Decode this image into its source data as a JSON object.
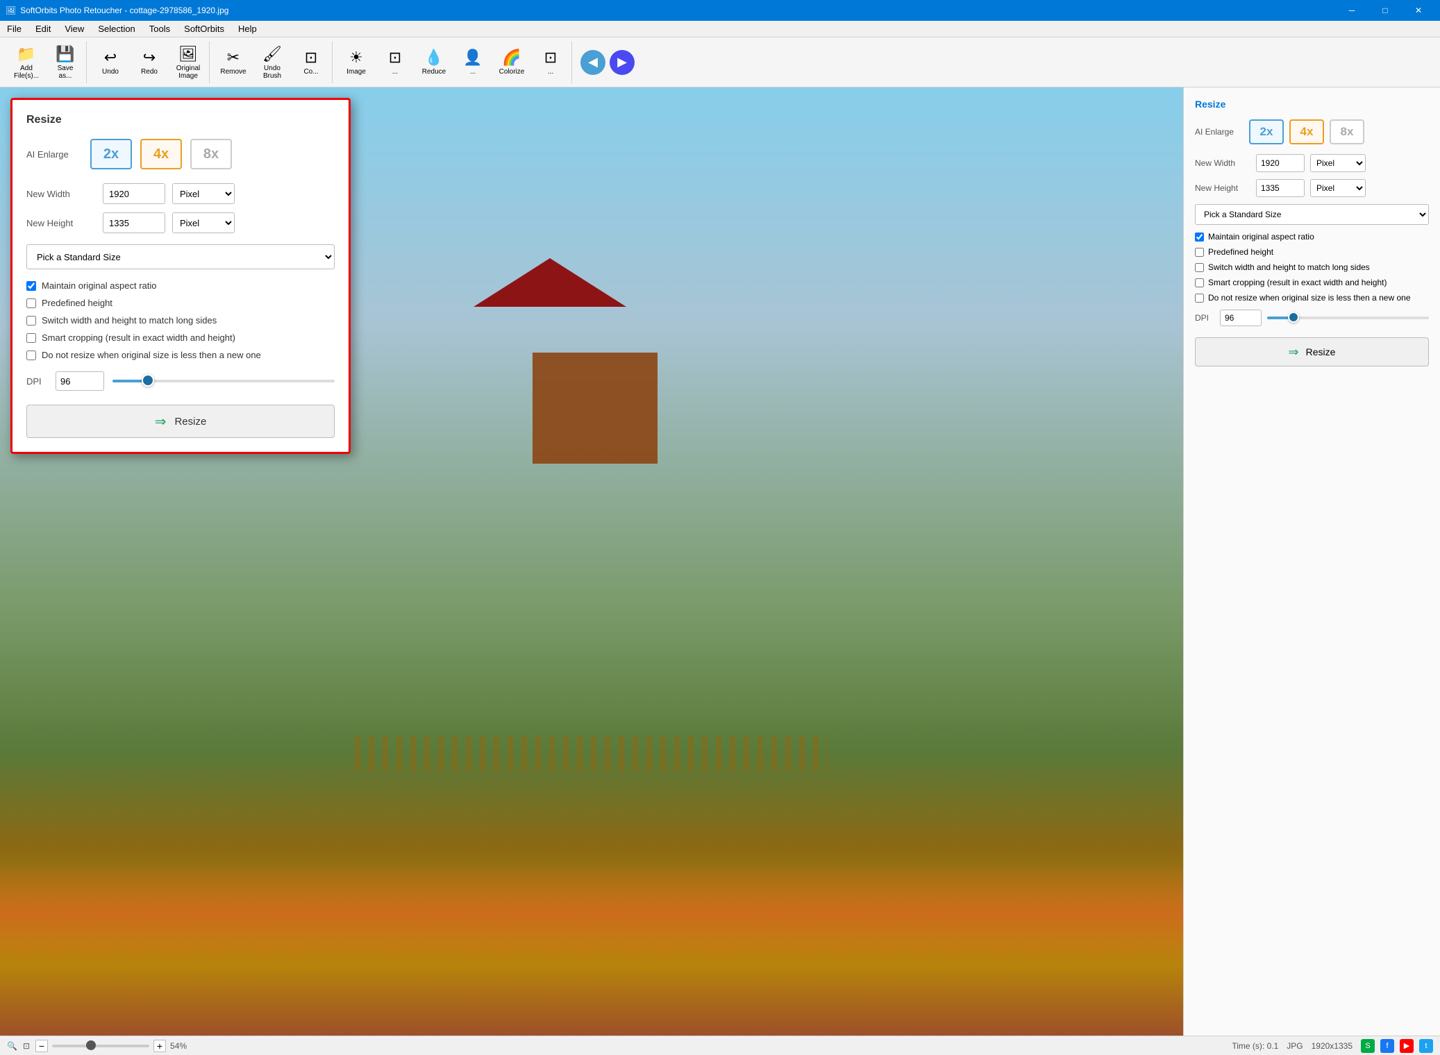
{
  "titleBar": {
    "icon": "🖼",
    "title": "SoftOrbits Photo Retoucher - cottage-2978586_1920.jpg",
    "minimize": "─",
    "maximize": "□",
    "close": "✕"
  },
  "menuBar": {
    "items": [
      "File",
      "Edit",
      "View",
      "Selection",
      "Tools",
      "SoftOrbits",
      "Help"
    ]
  },
  "toolbar": {
    "tools": [
      {
        "icon": "📁",
        "label": "Add\nFile(s)..."
      },
      {
        "icon": "💾",
        "label": "Save\nas..."
      },
      {
        "icon": "↩",
        "label": "Undo"
      },
      {
        "icon": "↪",
        "label": "Redo"
      },
      {
        "icon": "🖼",
        "label": "Original\nImage"
      },
      {
        "icon": "✂",
        "label": "Remove"
      },
      {
        "icon": "🖌",
        "label": "Undo\nBrush"
      },
      {
        "icon": "◉",
        "label": "Co..."
      },
      {
        "icon": "☀",
        "label": "Image"
      },
      {
        "icon": "⊡",
        "label": "..."
      },
      {
        "icon": "💧",
        "label": "Reduce"
      },
      {
        "icon": "👤",
        "label": "..."
      },
      {
        "icon": "🌈",
        "label": "Colorize"
      },
      {
        "icon": "⊡",
        "label": "..."
      }
    ],
    "navPrev": "◀",
    "navNext": "▶"
  },
  "dialog": {
    "title": "Resize",
    "aiEnlargeLabel": "AI Enlarge",
    "enlarge2x": "2x",
    "enlarge4x": "4x",
    "enlarge8x": "8x",
    "newWidthLabel": "New Width",
    "newWidthValue": "1920",
    "widthUnit": "Pixel",
    "newHeightLabel": "New Height",
    "newHeightValue": "1335",
    "heightUnit": "Pixel",
    "standardSizePlaceholder": "Pick a Standard Size",
    "checkboxes": [
      {
        "id": "cb1",
        "label": "Maintain original aspect ratio",
        "checked": true
      },
      {
        "id": "cb2",
        "label": "Predefined height",
        "checked": false
      },
      {
        "id": "cb3",
        "label": "Switch width and height to match long sides",
        "checked": false
      },
      {
        "id": "cb4",
        "label": "Smart cropping (result in exact width and height)",
        "checked": false
      },
      {
        "id": "cb5",
        "label": "Do not resize when original size is less then a new one",
        "checked": false
      }
    ],
    "dpiLabel": "DPI",
    "dpiValue": "96",
    "resizeArrow": "⇒",
    "resizeLabel": "Resize"
  },
  "panel": {
    "title": "Resize",
    "aiEnlargeLabel": "AI Enlarge",
    "enlarge2x": "2x",
    "enlarge4x": "4x",
    "enlarge8x": "8x",
    "newWidthLabel": "New Width",
    "newWidthValue": "1920",
    "widthUnit": "Pixel",
    "newHeightLabel": "New Height",
    "newHeightValue": "1335",
    "heightUnit": "Pixel",
    "standardSizePlaceholder": "Pick a Standard Size",
    "checkboxes": [
      {
        "label": "Maintain original aspect ratio",
        "checked": true
      },
      {
        "label": "Predefined height",
        "checked": false
      },
      {
        "label": "Switch width and height to match long sides",
        "checked": false
      },
      {
        "label": "Smart cropping (result in exact width and height)",
        "checked": false
      },
      {
        "label": "Do not resize when original size is less then a new one",
        "checked": false
      }
    ],
    "dpiLabel": "DPI",
    "dpiValue": "96",
    "resizeArrow": "⇒",
    "resizeLabel": "Resize"
  },
  "statusBar": {
    "time": "Time (s): 0.1",
    "format": "JPG",
    "dimensions": "1920x1335",
    "zoom": "54%"
  }
}
